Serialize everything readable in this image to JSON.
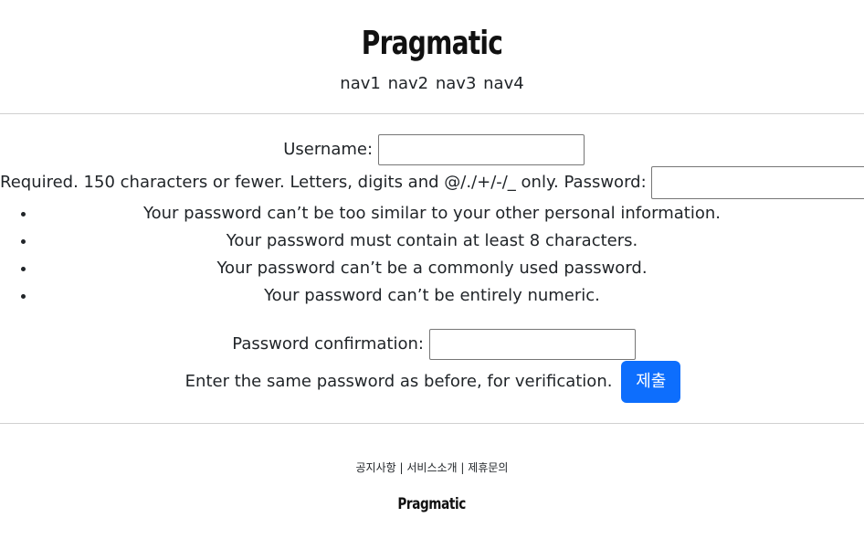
{
  "header": {
    "logo": "Pragmatic",
    "nav": [
      "nav1",
      "nav2",
      "nav3",
      "nav4"
    ]
  },
  "form": {
    "username_label": "Username:",
    "username_help": "Required. 150 characters or fewer. Letters, digits and @/./+/-/_ only.",
    "password_label": "Password:",
    "password_rules": [
      "Your password can’t be too similar to your other personal information.",
      "Your password must contain at least 8 characters.",
      "Your password can’t be a commonly used password.",
      "Your password can’t be entirely numeric."
    ],
    "confirm_label": "Password confirmation:",
    "confirm_help": "Enter the same password as before, for verification.",
    "submit_label": "제출"
  },
  "footer": {
    "links": [
      "공지사항",
      "서비스소개",
      "제휴문의"
    ],
    "separator": "|",
    "logo": "Pragmatic"
  }
}
